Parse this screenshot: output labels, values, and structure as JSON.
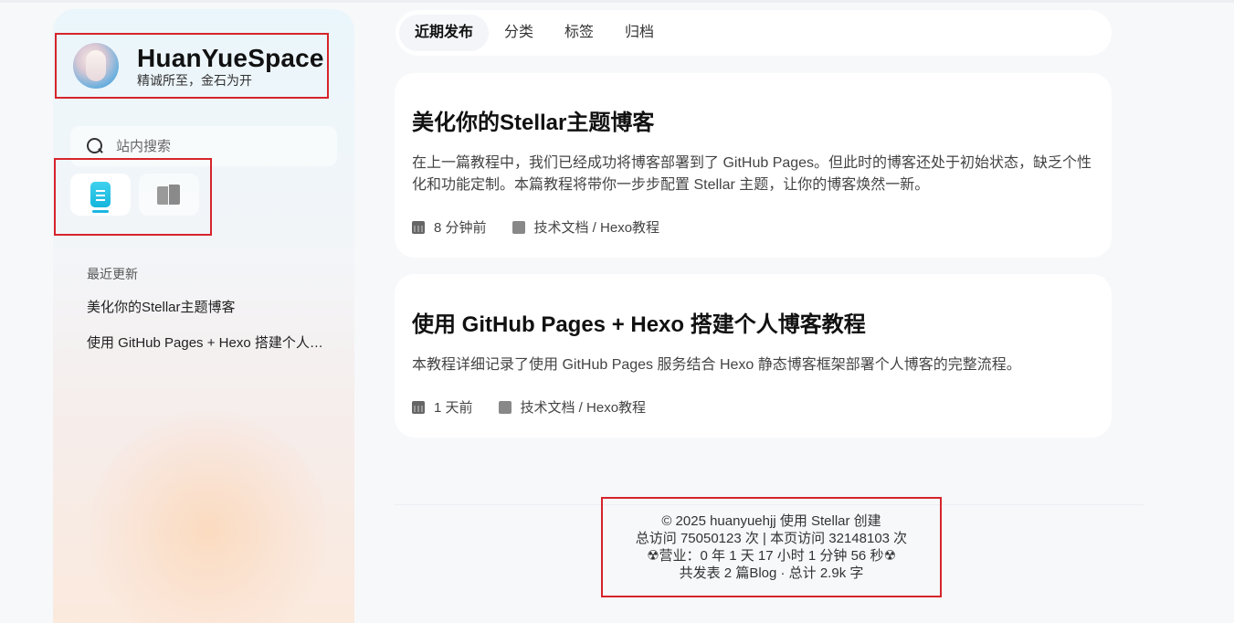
{
  "sidebar": {
    "brand_title": "HuanYueSpace",
    "brand_subtitle": "精诚所至，金石为开",
    "search_placeholder": "站内搜索",
    "recent_title": "最近更新",
    "recent_items": [
      "美化你的Stellar主题博客",
      "使用 GitHub Pages + Hexo 搭建个人博客教程"
    ]
  },
  "tabs": [
    "近期发布",
    "分类",
    "标签",
    "归档"
  ],
  "posts": [
    {
      "title": "美化你的Stellar主题博客",
      "desc": "在上一篇教程中，我们已经成功将博客部署到了 GitHub Pages。但此时的博客还处于初始状态，缺乏个性化和功能定制。本篇教程将带你一步步配置 Stellar 主题，让你的博客焕然一新。",
      "time": "8 分钟前",
      "category": "技术文档 / Hexo教程"
    },
    {
      "title": "使用 GitHub Pages + Hexo 搭建个人博客教程",
      "desc": "本教程详细记录了使用 GitHub Pages 服务结合 Hexo 静态博客框架部署个人博客的完整流程。",
      "time": "1 天前",
      "category": "技术文档 / Hexo教程"
    }
  ],
  "footer": {
    "line1": "© 2025 huanyuehjj 使用 Stellar 创建",
    "line2": "总访问 75050123 次 | 本页访问 32148103 次",
    "line3": "☢营业：0 年 1 天 17 小时 1 分钟 56 秒☢",
    "line4": "共发表 2 篇Blog · 总计 2.9k 字"
  },
  "colors": {
    "accent": "#1ab6e1",
    "highlight_border": "#d6242b"
  }
}
